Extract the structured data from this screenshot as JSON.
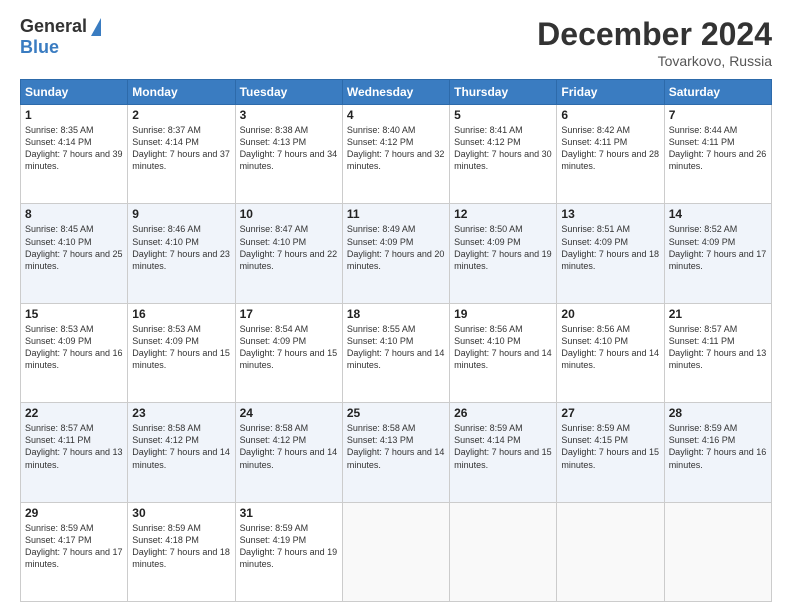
{
  "logo": {
    "general": "General",
    "blue": "Blue"
  },
  "title": "December 2024",
  "location": "Tovarkovo, Russia",
  "days_header": [
    "Sunday",
    "Monday",
    "Tuesday",
    "Wednesday",
    "Thursday",
    "Friday",
    "Saturday"
  ],
  "weeks": [
    [
      {
        "day": "1",
        "sunrise": "Sunrise: 8:35 AM",
        "sunset": "Sunset: 4:14 PM",
        "daylight": "Daylight: 7 hours and 39 minutes."
      },
      {
        "day": "2",
        "sunrise": "Sunrise: 8:37 AM",
        "sunset": "Sunset: 4:14 PM",
        "daylight": "Daylight: 7 hours and 37 minutes."
      },
      {
        "day": "3",
        "sunrise": "Sunrise: 8:38 AM",
        "sunset": "Sunset: 4:13 PM",
        "daylight": "Daylight: 7 hours and 34 minutes."
      },
      {
        "day": "4",
        "sunrise": "Sunrise: 8:40 AM",
        "sunset": "Sunset: 4:12 PM",
        "daylight": "Daylight: 7 hours and 32 minutes."
      },
      {
        "day": "5",
        "sunrise": "Sunrise: 8:41 AM",
        "sunset": "Sunset: 4:12 PM",
        "daylight": "Daylight: 7 hours and 30 minutes."
      },
      {
        "day": "6",
        "sunrise": "Sunrise: 8:42 AM",
        "sunset": "Sunset: 4:11 PM",
        "daylight": "Daylight: 7 hours and 28 minutes."
      },
      {
        "day": "7",
        "sunrise": "Sunrise: 8:44 AM",
        "sunset": "Sunset: 4:11 PM",
        "daylight": "Daylight: 7 hours and 26 minutes."
      }
    ],
    [
      {
        "day": "8",
        "sunrise": "Sunrise: 8:45 AM",
        "sunset": "Sunset: 4:10 PM",
        "daylight": "Daylight: 7 hours and 25 minutes."
      },
      {
        "day": "9",
        "sunrise": "Sunrise: 8:46 AM",
        "sunset": "Sunset: 4:10 PM",
        "daylight": "Daylight: 7 hours and 23 minutes."
      },
      {
        "day": "10",
        "sunrise": "Sunrise: 8:47 AM",
        "sunset": "Sunset: 4:10 PM",
        "daylight": "Daylight: 7 hours and 22 minutes."
      },
      {
        "day": "11",
        "sunrise": "Sunrise: 8:49 AM",
        "sunset": "Sunset: 4:09 PM",
        "daylight": "Daylight: 7 hours and 20 minutes."
      },
      {
        "day": "12",
        "sunrise": "Sunrise: 8:50 AM",
        "sunset": "Sunset: 4:09 PM",
        "daylight": "Daylight: 7 hours and 19 minutes."
      },
      {
        "day": "13",
        "sunrise": "Sunrise: 8:51 AM",
        "sunset": "Sunset: 4:09 PM",
        "daylight": "Daylight: 7 hours and 18 minutes."
      },
      {
        "day": "14",
        "sunrise": "Sunrise: 8:52 AM",
        "sunset": "Sunset: 4:09 PM",
        "daylight": "Daylight: 7 hours and 17 minutes."
      }
    ],
    [
      {
        "day": "15",
        "sunrise": "Sunrise: 8:53 AM",
        "sunset": "Sunset: 4:09 PM",
        "daylight": "Daylight: 7 hours and 16 minutes."
      },
      {
        "day": "16",
        "sunrise": "Sunrise: 8:53 AM",
        "sunset": "Sunset: 4:09 PM",
        "daylight": "Daylight: 7 hours and 15 minutes."
      },
      {
        "day": "17",
        "sunrise": "Sunrise: 8:54 AM",
        "sunset": "Sunset: 4:09 PM",
        "daylight": "Daylight: 7 hours and 15 minutes."
      },
      {
        "day": "18",
        "sunrise": "Sunrise: 8:55 AM",
        "sunset": "Sunset: 4:10 PM",
        "daylight": "Daylight: 7 hours and 14 minutes."
      },
      {
        "day": "19",
        "sunrise": "Sunrise: 8:56 AM",
        "sunset": "Sunset: 4:10 PM",
        "daylight": "Daylight: 7 hours and 14 minutes."
      },
      {
        "day": "20",
        "sunrise": "Sunrise: 8:56 AM",
        "sunset": "Sunset: 4:10 PM",
        "daylight": "Daylight: 7 hours and 14 minutes."
      },
      {
        "day": "21",
        "sunrise": "Sunrise: 8:57 AM",
        "sunset": "Sunset: 4:11 PM",
        "daylight": "Daylight: 7 hours and 13 minutes."
      }
    ],
    [
      {
        "day": "22",
        "sunrise": "Sunrise: 8:57 AM",
        "sunset": "Sunset: 4:11 PM",
        "daylight": "Daylight: 7 hours and 13 minutes."
      },
      {
        "day": "23",
        "sunrise": "Sunrise: 8:58 AM",
        "sunset": "Sunset: 4:12 PM",
        "daylight": "Daylight: 7 hours and 14 minutes."
      },
      {
        "day": "24",
        "sunrise": "Sunrise: 8:58 AM",
        "sunset": "Sunset: 4:12 PM",
        "daylight": "Daylight: 7 hours and 14 minutes."
      },
      {
        "day": "25",
        "sunrise": "Sunrise: 8:58 AM",
        "sunset": "Sunset: 4:13 PM",
        "daylight": "Daylight: 7 hours and 14 minutes."
      },
      {
        "day": "26",
        "sunrise": "Sunrise: 8:59 AM",
        "sunset": "Sunset: 4:14 PM",
        "daylight": "Daylight: 7 hours and 15 minutes."
      },
      {
        "day": "27",
        "sunrise": "Sunrise: 8:59 AM",
        "sunset": "Sunset: 4:15 PM",
        "daylight": "Daylight: 7 hours and 15 minutes."
      },
      {
        "day": "28",
        "sunrise": "Sunrise: 8:59 AM",
        "sunset": "Sunset: 4:16 PM",
        "daylight": "Daylight: 7 hours and 16 minutes."
      }
    ],
    [
      {
        "day": "29",
        "sunrise": "Sunrise: 8:59 AM",
        "sunset": "Sunset: 4:17 PM",
        "daylight": "Daylight: 7 hours and 17 minutes."
      },
      {
        "day": "30",
        "sunrise": "Sunrise: 8:59 AM",
        "sunset": "Sunset: 4:18 PM",
        "daylight": "Daylight: 7 hours and 18 minutes."
      },
      {
        "day": "31",
        "sunrise": "Sunrise: 8:59 AM",
        "sunset": "Sunset: 4:19 PM",
        "daylight": "Daylight: 7 hours and 19 minutes."
      },
      null,
      null,
      null,
      null
    ]
  ]
}
